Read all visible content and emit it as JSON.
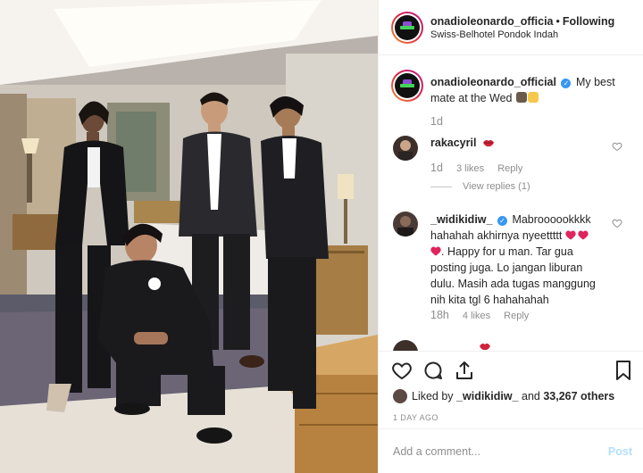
{
  "header": {
    "username": "onadioleonardo_officia",
    "separator": "•",
    "follow_status": "Following",
    "location": "Swiss-Belhotel Pondok Indah"
  },
  "caption": {
    "username": "onadioleonardo_official",
    "verified_mark": "✓",
    "text_line1": "My best",
    "text_line2": "mate at the Wed",
    "time": "1d"
  },
  "comments": [
    {
      "username": "rakacyril",
      "emoji": "lips",
      "time": "1d",
      "likes": "3 likes",
      "reply": "Reply",
      "view_replies": "View replies (1)"
    },
    {
      "username": "_widikidiw_",
      "verified_mark": "✓",
      "line1": "Mabroooookkkk",
      "line2": "hahahah akhirnya nyeettttt",
      "line3": ". Happy for u man. Tar gua",
      "line4": "posting juga. Lo jangan liburan",
      "line5": "dulu. Masih ada tugas manggung",
      "line6": "nih kita tgl 6 hahahahah",
      "time": "18h",
      "likes": "4 likes",
      "reply": "Reply"
    }
  ],
  "actions": {
    "liked_by_prefix": "Liked by",
    "liked_by_user": "_widikidiw_",
    "liked_by_and": "and",
    "liked_by_others": "33,267 others",
    "date": "1 DAY AGO"
  },
  "add_comment": {
    "placeholder": "Add a comment...",
    "post_label": "Post"
  },
  "colors": {
    "heart_red": "#e0245e",
    "link_blue": "#3897f0",
    "post_disabled": "#b2dffc"
  }
}
